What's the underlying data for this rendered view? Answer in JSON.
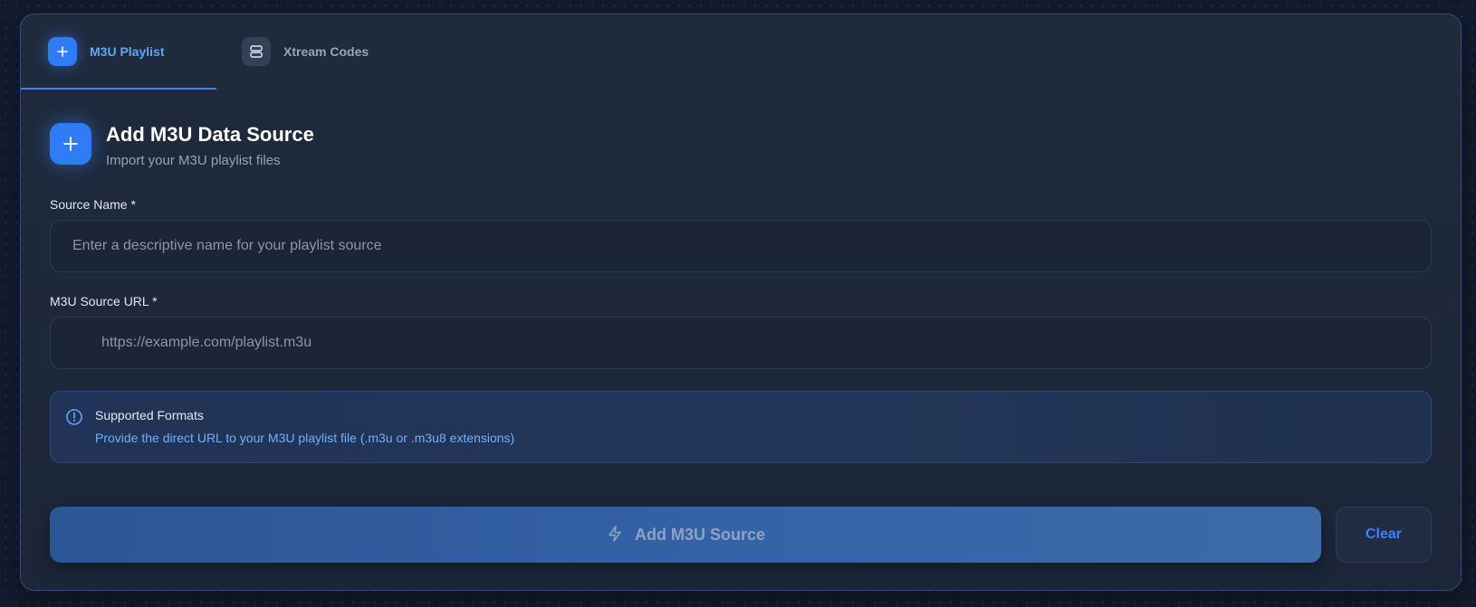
{
  "tabs": [
    {
      "label": "M3U Playlist",
      "icon": "plus-icon",
      "active": true
    },
    {
      "label": "Xtream Codes",
      "icon": "server-icon",
      "active": false
    }
  ],
  "header": {
    "icon": "plus-icon",
    "title": "Add M3U Data Source",
    "subtitle": "Import your M3U playlist files"
  },
  "form": {
    "source_name": {
      "label": "Source Name *",
      "value": "",
      "placeholder": "Enter a descriptive name for your playlist source"
    },
    "source_url": {
      "label": "M3U Source URL *",
      "value": "",
      "placeholder": "https://example.com/playlist.m3u"
    }
  },
  "info": {
    "icon": "info-circle-icon",
    "title": "Supported Formats",
    "text": "Provide the direct URL to your M3U playlist file (.m3u or .m3u8 extensions)"
  },
  "actions": {
    "add_label": "Add M3U Source",
    "add_icon": "lightning-icon",
    "clear_label": "Clear"
  },
  "colors": {
    "accent": "#3b82f6",
    "background": "#121b2c",
    "card": "#1f2a3d",
    "info_text": "#6fb0ff"
  }
}
